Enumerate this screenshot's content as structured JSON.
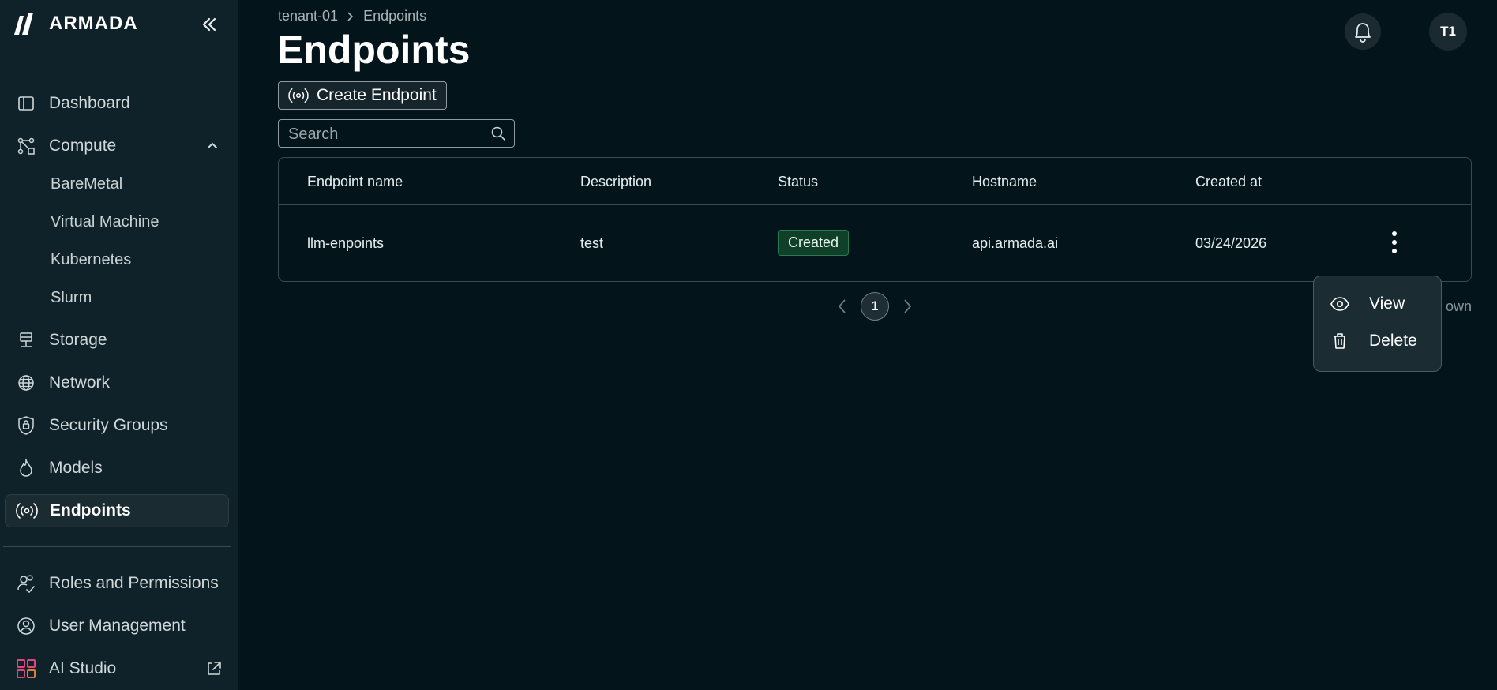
{
  "brand": {
    "name": "ARMADA"
  },
  "sidebar": {
    "items": [
      {
        "label": "Dashboard"
      },
      {
        "label": "Compute"
      },
      {
        "label": "Storage"
      },
      {
        "label": "Network"
      },
      {
        "label": "Security Groups"
      },
      {
        "label": "Models"
      },
      {
        "label": "Endpoints"
      },
      {
        "label": "Roles and Permissions"
      },
      {
        "label": "User Management"
      },
      {
        "label": "AI Studio"
      }
    ],
    "compute_sub": [
      {
        "label": "BareMetal"
      },
      {
        "label": "Virtual Machine"
      },
      {
        "label": "Kubernetes"
      },
      {
        "label": "Slurm"
      }
    ]
  },
  "header": {
    "breadcrumb": [
      "tenant-01",
      "Endpoints"
    ],
    "title": "Endpoints",
    "avatar_initials": "T1"
  },
  "toolbar": {
    "create_label": "Create Endpoint",
    "search_placeholder": "Search"
  },
  "table": {
    "columns": [
      "Endpoint name",
      "Description",
      "Status",
      "Hostname",
      "Created at"
    ],
    "rows": [
      {
        "name": "llm-enpoints",
        "description": "test",
        "status": "Created",
        "hostname": "api.armada.ai",
        "created_at": "03/24/2026"
      }
    ]
  },
  "pagination": {
    "current_page": "1",
    "shown_text": "own"
  },
  "context_menu": {
    "items": [
      {
        "label": "View"
      },
      {
        "label": "Delete"
      }
    ]
  },
  "colors": {
    "background": "#03141a",
    "sidebar": "#0f2229",
    "status_created": "#11402a"
  }
}
